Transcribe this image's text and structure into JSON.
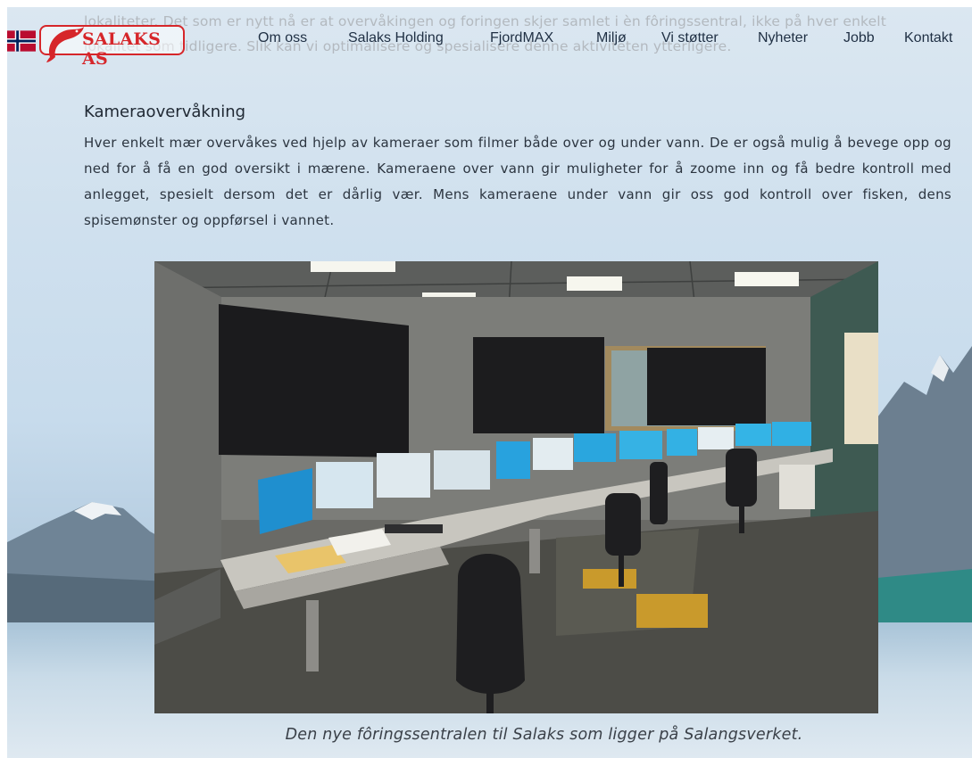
{
  "prior_text": {
    "line1": "lokaliteter. Det som er nytt nå er at overvåkingen og foringen skjer samlet i èn fôringssentral, ikke på hver enkelt",
    "line2": "lokalitet som tidligere. Slik kan vi optimalisere og spesialisere denne aktiviteten ytterligere."
  },
  "header": {
    "flag_icon": "norway-flag-icon",
    "logo_text": "SALAKS AS",
    "nav": [
      {
        "label": "Om oss"
      },
      {
        "label": "Salaks Holding"
      },
      {
        "label": "FjordMAX"
      },
      {
        "label": "Miljø"
      },
      {
        "label": "Vi støtter"
      },
      {
        "label": "Nyheter"
      },
      {
        "label": "Jobb"
      },
      {
        "label": "Kontakt"
      }
    ]
  },
  "section": {
    "title": "Kameraovervåkning",
    "body": "Hver enkelt mær overvåkes ved hjelp av kameraer som filmer både over og under vann. De er også mulig å bevege opp og ned for å få en god oversikt i mærene. Kameraene over vann gir muligheter for å zoome inn og få bedre kontroll med anlegget, spesielt dersom det er dårlig vær. Mens kameraene under vann gir oss god kontroll over fisken, dens spisemønster og oppførsel i vannet."
  },
  "photo": {
    "caption": "Den nye fôringssentralen til Salaks som ligger på Salangsverket."
  },
  "colors": {
    "brand_red": "#d6262a",
    "nav_text": "#1f2f43"
  }
}
